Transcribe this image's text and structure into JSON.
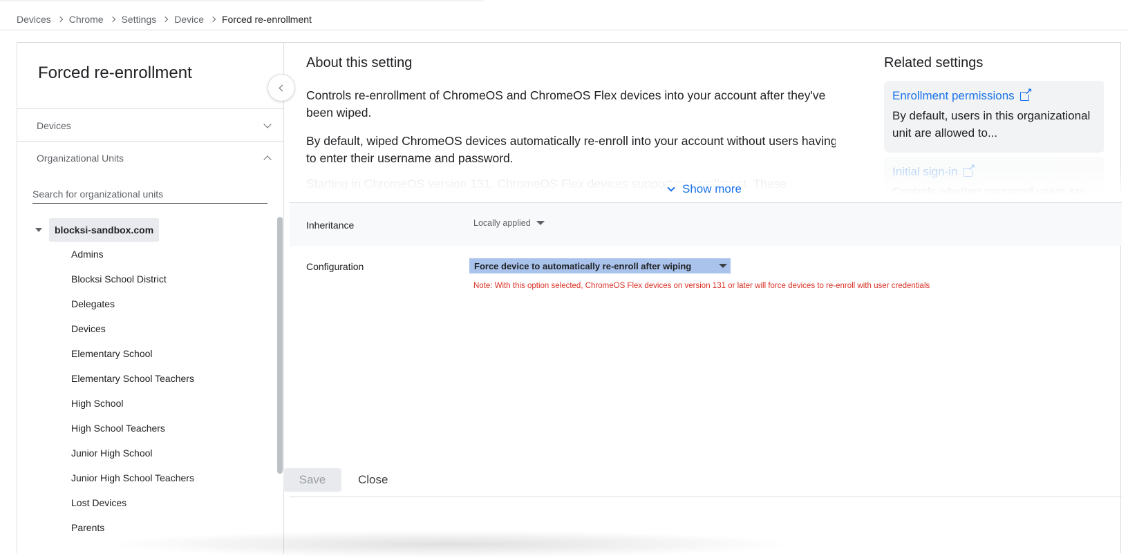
{
  "breadcrumb": [
    "Devices",
    "Chrome",
    "Settings",
    "Device",
    "Forced re-enrollment"
  ],
  "left_panel": {
    "title": "Forced re-enrollment",
    "sections": [
      {
        "label": "Devices",
        "expanded": false
      },
      {
        "label": "Organizational Units",
        "expanded": true
      }
    ],
    "search_placeholder": "Search for organizational units",
    "root_ou": "blocksi-sandbox.com",
    "org_units": [
      "Admins",
      "Blocksi School District",
      "Delegates",
      "Devices",
      "Elementary School",
      "Elementary School Teachers",
      "High School",
      "High School Teachers",
      "Junior High School",
      "Junior High School Teachers",
      "Lost Devices",
      "Parents"
    ]
  },
  "about": {
    "heading": "About this setting",
    "paragraphs": [
      "Controls re-enrollment of ChromeOS and ChromeOS Flex devices into your account after they've been wiped.",
      "By default, wiped ChromeOS devices automatically re-enroll into your account without users having to enter their username and password.",
      "Starting in ChromeOS version 131, ChromeOS Flex devices support re-enrollment. These"
    ],
    "show_more": "Show more"
  },
  "related": {
    "heading": "Related settings",
    "items": [
      {
        "title": "Enrollment permissions",
        "description": "By default, users in this organizational unit are allowed to..."
      },
      {
        "title": "Initial sign-in",
        "description": "Controls whether managed users are"
      }
    ]
  },
  "settings": {
    "inheritance_label": "Inheritance",
    "inheritance_value": "Locally applied",
    "configuration_label": "Configuration",
    "configuration_value": "Force device to automatically re-enroll after wiping",
    "configuration_note": "Note: With this option selected, ChromeOS Flex devices on version 131 or later will force devices to re-enroll with user credentials"
  },
  "footer": {
    "save": "Save",
    "close": "Close"
  },
  "colors": {
    "accent": "#1a73e8",
    "selected_option_bg": "#a9c3ec",
    "note": "#d93025"
  }
}
